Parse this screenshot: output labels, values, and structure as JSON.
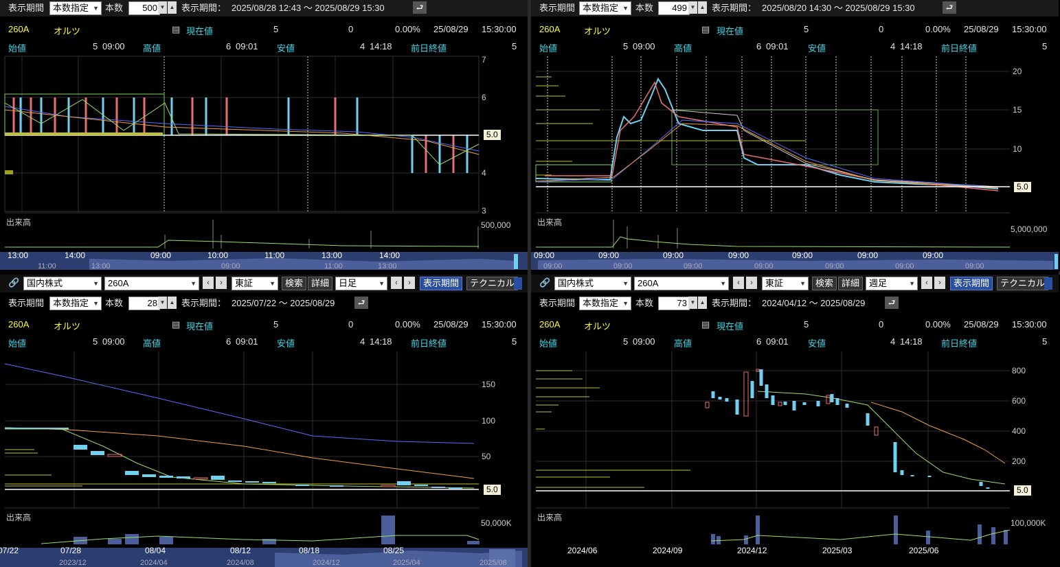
{
  "common": {
    "period_label": "表示期間",
    "mode": "本数指定",
    "count_label": "本数",
    "range_label": "表示期間：",
    "code": "260A",
    "name": "オルツ",
    "current_label": "現在値",
    "current_value": "5",
    "change": "0",
    "change_pct": "0.00%",
    "date": "25/08/29",
    "time": "15:30:00",
    "open_label": "始値",
    "open_value": "5",
    "open_time": "09:00",
    "high_label": "高値",
    "high_value": "6",
    "high_time": "09:01",
    "low_label": "安値",
    "low_value": "4",
    "low_time": "14:18",
    "prev_label": "前日終値",
    "prev_value": "5",
    "volume_label": "出来高",
    "price_tag": "5.0",
    "market_select": "国内株式",
    "exchange_select": "東証",
    "search_btn": "検索",
    "detail_btn": "詳細",
    "period_btn": "表示期間",
    "technical_btn": "テクニカル"
  },
  "panels": [
    {
      "count": "500",
      "range": "2025/08/28 12:43 ～ 2025/08/29 15:30",
      "y_ticks": [
        "7",
        "6",
        "5",
        "4",
        "3"
      ],
      "vol_tick": "500,000",
      "x_ticks": [
        "13:00",
        "14:00",
        "09:00",
        "10:00",
        "11:00",
        "13:00",
        "14:00"
      ],
      "scroll_ticks": [
        "11:00",
        "13:00",
        "09:00",
        "11:00",
        "13:00"
      ]
    },
    {
      "count": "499",
      "range": "2025/08/20 14:30 ～ 2025/08/29 15:30",
      "y_ticks": [
        "20",
        "15",
        "10",
        "5"
      ],
      "vol_tick": "5,000,000",
      "x_ticks": [
        "09:00",
        "09:00",
        "09:00",
        "09:00",
        "09:00",
        "09:00",
        "09:00",
        "09:00"
      ],
      "scroll_ticks": [
        "09:00",
        "09:00",
        "09:00",
        "09:00",
        "09:00",
        "09:00",
        "09:00"
      ]
    },
    {
      "count": "28",
      "range": "2025/07/22 ～ 2025/08/29",
      "timeframe": "日足",
      "y_ticks": [
        "150",
        "100",
        "50"
      ],
      "vol_tick": "50,000K",
      "x_ticks": [
        "07/22",
        "07/28",
        "08/04",
        "08/12",
        "08/18",
        "08/25"
      ],
      "scroll_ticks": [
        "2023/12",
        "2024/04",
        "2024/08",
        "2024/12",
        "2025/04",
        "2025/08"
      ]
    },
    {
      "count": "73",
      "range": "2024/04/12 ～ 2025/08/29",
      "timeframe": "週足",
      "y_ticks": [
        "800",
        "600",
        "400",
        "200"
      ],
      "vol_tick": "100,000K",
      "x_ticks": [
        "2024/06",
        "2024/09",
        "2024/12",
        "2025/03",
        "2025/06"
      ]
    }
  ]
}
